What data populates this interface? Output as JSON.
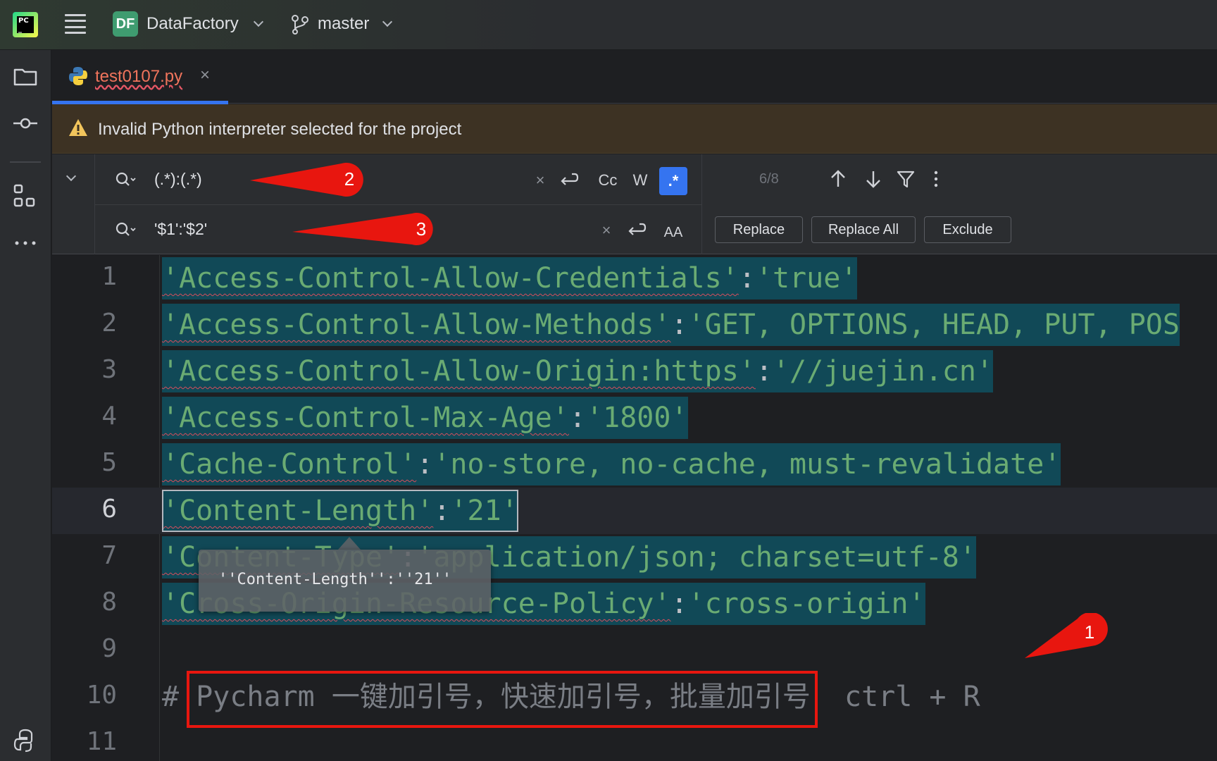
{
  "titlebar": {
    "project_badge": "DF",
    "project_name": "DataFactory",
    "branch_name": "master"
  },
  "tabs": [
    {
      "label": "test0107.py",
      "close": "×"
    }
  ],
  "banner": {
    "text": "Invalid Python interpreter selected for the project"
  },
  "find": {
    "search_value": "(.*):(.*)",
    "replace_value": "'$1':'$2'",
    "match_count": "6/8",
    "clear_glyph": "×",
    "case_label": "Cc",
    "word_label": "W",
    "regex_label": ".*",
    "preserve_case_label": "AA",
    "replace_label": "Replace",
    "replace_all_label": "Replace All",
    "exclude_label": "Exclude"
  },
  "editor": {
    "lines": [
      {
        "num": "1",
        "key": "'Access-Control-Allow-Credentials'",
        "sep": ":",
        "val": "'true'"
      },
      {
        "num": "2",
        "key": "'Access-Control-Allow-Methods'",
        "sep": ":",
        "val": "'GET, OPTIONS, HEAD, PUT, POS"
      },
      {
        "num": "3",
        "key": "'Access-Control-Allow-Origin:https'",
        "sep": ":",
        "val": "'//juejin.cn'"
      },
      {
        "num": "4",
        "key": "'Access-Control-Max-Age'",
        "sep": ":",
        "val": "'1800'"
      },
      {
        "num": "5",
        "key": "'Cache-Control'",
        "sep": ":",
        "val": "'no-store, no-cache, must-revalidate'"
      },
      {
        "num": "6",
        "key": "'Content-Length'",
        "sep": ":",
        "val": "'21'"
      },
      {
        "num": "7",
        "key": "'Content-Type'",
        "sep": ":",
        "val": "'application/json; charset=utf-8'"
      },
      {
        "num": "8",
        "key": "'Cross-Origin-Resource-Policy'",
        "sep": ":",
        "val": "'cross-origin'"
      },
      {
        "num": "9"
      },
      {
        "num": "10",
        "hash": "#",
        "comment": " Pycharm 一键加引号，快速加引号，批量加引号",
        "shortcut": "  ctrl + R"
      },
      {
        "num": "11"
      }
    ],
    "tooltip": "''Content-Length'':''21''"
  },
  "callouts": [
    "1",
    "2",
    "3"
  ],
  "colors": {
    "accent": "#3574f0",
    "match_highlight": "#114957",
    "string": "#6aab73",
    "callout_red": "#e8160f"
  }
}
